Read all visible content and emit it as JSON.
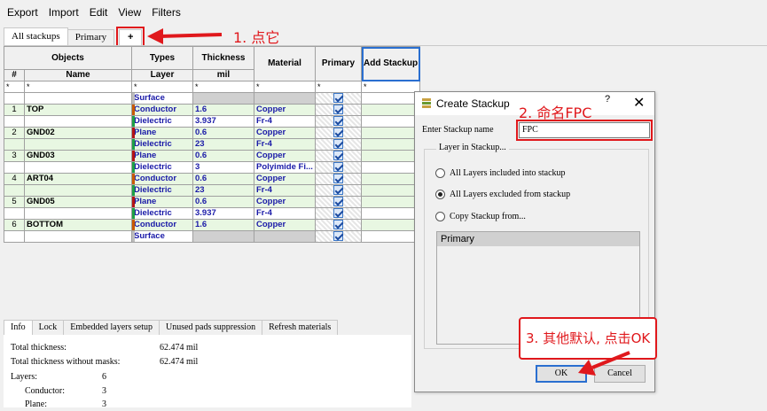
{
  "menu": [
    "Export",
    "Import",
    "Edit",
    "View",
    "Filters"
  ],
  "tabs": [
    "All stackups",
    "Primary",
    "+"
  ],
  "grid": {
    "headers": {
      "objects": "Objects",
      "types": "Types",
      "thickness": "Thickness",
      "material": "Material",
      "primary": "Primary",
      "add_stackup": "Add Stackup",
      "num": "#",
      "name": "Name",
      "layer": "Layer",
      "unit": "mil"
    },
    "filter": "*",
    "rows": [
      {
        "num": "",
        "name": "",
        "type": "Surface",
        "thickness": "",
        "material": "",
        "color": "#bdbdbd",
        "style": "white",
        "gray": true
      },
      {
        "num": "1",
        "name": "TOP",
        "type": "Conductor",
        "thickness": "1.6",
        "material": "Copper",
        "color": "#c85a00",
        "style": "green"
      },
      {
        "num": "",
        "name": "",
        "type": "Dielectric",
        "thickness": "3.937",
        "material": "Fr-4",
        "color": "#1ea046",
        "style": "white"
      },
      {
        "num": "2",
        "name": "GND02",
        "type": "Plane",
        "thickness": "0.6",
        "material": "Copper",
        "color": "#b41414",
        "style": "green"
      },
      {
        "num": "",
        "name": "",
        "type": "Dielectric",
        "thickness": "23",
        "material": "Fr-4",
        "color": "#1ea046",
        "style": "green"
      },
      {
        "num": "3",
        "name": "GND03",
        "type": "Plane",
        "thickness": "0.6",
        "material": "Copper",
        "color": "#b41414",
        "style": "green"
      },
      {
        "num": "",
        "name": "",
        "type": "Dielectric",
        "thickness": "3",
        "material": "Polyimide Fi...",
        "color": "#1ea046",
        "style": "white"
      },
      {
        "num": "4",
        "name": "ART04",
        "type": "Conductor",
        "thickness": "0.6",
        "material": "Copper",
        "color": "#c85a00",
        "style": "green"
      },
      {
        "num": "",
        "name": "",
        "type": "Dielectric",
        "thickness": "23",
        "material": "Fr-4",
        "color": "#1ea046",
        "style": "green"
      },
      {
        "num": "5",
        "name": "GND05",
        "type": "Plane",
        "thickness": "0.6",
        "material": "Copper",
        "color": "#b41414",
        "style": "green"
      },
      {
        "num": "",
        "name": "",
        "type": "Dielectric",
        "thickness": "3.937",
        "material": "Fr-4",
        "color": "#1ea046",
        "style": "white"
      },
      {
        "num": "6",
        "name": "BOTTOM",
        "type": "Conductor",
        "thickness": "1.6",
        "material": "Copper",
        "color": "#c85a00",
        "style": "green"
      },
      {
        "num": "",
        "name": "",
        "type": "Surface",
        "thickness": "",
        "material": "",
        "color": "#bdbdbd",
        "style": "white",
        "gray": true
      }
    ]
  },
  "bottom_tabs": [
    "Info",
    "Lock",
    "Embedded layers setup",
    "Unused pads suppression",
    "Refresh materials"
  ],
  "info": {
    "total_thickness_label": "Total thickness:",
    "total_thickness_value": "62.474 mil",
    "total_no_masks_label": "Total thickness without masks:",
    "total_no_masks_value": "62.474 mil",
    "layers_label": "Layers:",
    "layers_value": "6",
    "conductor_label": "Conductor:",
    "conductor_value": "3",
    "plane_label": "Plane:",
    "plane_value": "3"
  },
  "dialog": {
    "title": "Create Stackup",
    "help": "?",
    "close": "✕",
    "name_label": "Enter Stackup name",
    "name_value": "FPC",
    "group_title": "Layer in Stackup...",
    "options": [
      "All Layers included into stackup",
      "All Layers excluded from stackup",
      "Copy Stackup from..."
    ],
    "selected_option": 1,
    "list_items": [
      "Primary"
    ],
    "ok": "OK",
    "cancel": "Cancel"
  },
  "annotations": {
    "step1": "1. 点它",
    "step2": "2. 命名FPC",
    "step3": "3. 其他默认, 点击OK"
  },
  "colors": {
    "annotation_red": "#e0181c",
    "focus_blue": "#2a6fd0",
    "row_green": "#e8f7e2",
    "value_blue": "#1a1aa8"
  }
}
